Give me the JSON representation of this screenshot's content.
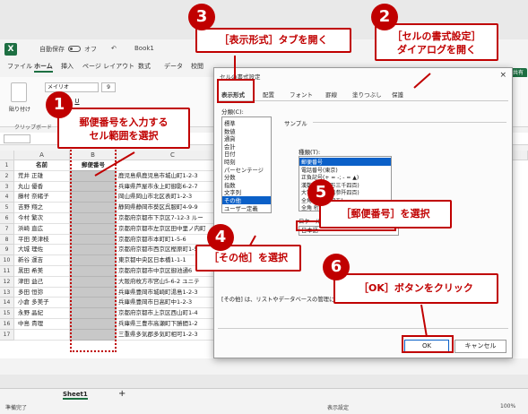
{
  "titlebar": {
    "autosave_label": "自動保存",
    "autosave_state": "オフ",
    "book_name": "Book1"
  },
  "menu_tabs": [
    "ファイル",
    "ホーム",
    "挿入",
    "ページ レイアウト",
    "数式",
    "データ",
    "校閲"
  ],
  "ribbon": {
    "font_name": "メイリオ",
    "font_size": "9",
    "bold": "B",
    "italic": "I",
    "underline": "U",
    "paste_label": "貼り付け",
    "clipboard_group": "クリップボード"
  },
  "sheet": {
    "col_headers": [
      "A",
      "B",
      "C"
    ],
    "header_name": "名前",
    "header_zip": "郵便番号",
    "rows": [
      {
        "num": "1",
        "name": "",
        "address": ""
      },
      {
        "num": "2",
        "name": "荒井 正雄",
        "address": "鹿児島県鹿児島市城山町1-2-3"
      },
      {
        "num": "3",
        "name": "丸山 優香",
        "address": "兵庫県芦屋市永上町御影6-2-7"
      },
      {
        "num": "4",
        "name": "藤村 奈緒子",
        "address": "岡山県岡山市北区表町1-2-3"
      },
      {
        "num": "5",
        "name": "吉野 翔之",
        "address": "静岡県静岡市葵区呉服町4-9-9"
      },
      {
        "num": "6",
        "name": "今村 繁次",
        "address": "京都府京都市下京区7-12-3 ルー"
      },
      {
        "num": "7",
        "name": "浜崎 直広",
        "address": "京都府京都市左京区田中里ノ内町"
      },
      {
        "num": "8",
        "name": "平田 美津枝",
        "address": "京都府京都市本町町1-5-6"
      },
      {
        "num": "9",
        "name": "大城 理佐",
        "address": "京都府京都市西京区樫原町1-5"
      },
      {
        "num": "10",
        "name": "新谷 運吉",
        "address": "東京都中央区日本橋1-1-1"
      },
      {
        "num": "11",
        "name": "黒田 希美",
        "address": "京都府京都市中京区御池通6"
      },
      {
        "num": "12",
        "name": "津田 益己",
        "address": "大阪府枚方市宮山5-6-2 ユニテ"
      },
      {
        "num": "13",
        "name": "多田 恒弥",
        "address": "兵庫県豊岡市城崎町湯島1-2-3"
      },
      {
        "num": "14",
        "name": "小倉 多美子",
        "address": "兵庫県豊岡市日高町中1-2-3"
      },
      {
        "num": "15",
        "name": "永野 晶紀",
        "address": "京都府京都市上京区西山町1-4"
      },
      {
        "num": "16",
        "name": "中島 貴理",
        "address": "兵庫県三豊市高瀬町下勝間1-2"
      },
      {
        "num": "17",
        "name": "",
        "address": "三重県多気郡多気町相可1-2-3"
      }
    ],
    "sheet_tab": "Sheet1",
    "add_sheet": "+"
  },
  "status": {
    "ready": "準備完了",
    "display_settings": "表示設定",
    "zoom": "100%"
  },
  "dialog": {
    "title": "セルの書式設定",
    "close": "×",
    "tabs": [
      "表示形式",
      "配置",
      "フォント",
      "罫線",
      "塗りつぶし",
      "保護"
    ],
    "category_label": "分類(C):",
    "categories": [
      "標準",
      "数値",
      "通貨",
      "会計",
      "日付",
      "時刻",
      "パーセンテージ",
      "分数",
      "指数",
      "文字列",
      "その他",
      "ユーザー定義"
    ],
    "selected_category": "その他",
    "sample_label": "サンプル",
    "kind_label": "種類(T):",
    "kinds": [
      "郵便番号",
      "電話番号(東京)",
      "正負記号(+ = -; - = ▲)",
      "漢数字(十二万三千四百)",
      "大字(壱拾弐萬参阡四百)",
      "全角(一二三四五)",
      "全角 桁区切り(一二、三四五)"
    ],
    "selected_kind": "郵便番号",
    "locale_label": "ロケール(国または地域)(L):",
    "locale_value": "日本語",
    "note": "[その他] は、リストやデータベースの管理に使用します。",
    "ok_label": "OK",
    "cancel_label": "キャンセル"
  },
  "callouts": [
    {
      "num": "1",
      "text": "郵便番号を入力する\nセル範囲を選択"
    },
    {
      "num": "2",
      "text": "［セルの書式設定］\nダイアログを開く"
    },
    {
      "num": "3",
      "text": "［表示形式］タブを開く"
    },
    {
      "num": "4",
      "text": "［その他］を選択"
    },
    {
      "num": "5",
      "text": "［郵便番号］を選択"
    },
    {
      "num": "6",
      "text": "［OK］ボタンをクリック"
    }
  ],
  "colors": {
    "accent_red": "#c00000",
    "excel_green": "#1d6f42",
    "selection_blue": "#0b60c8"
  }
}
